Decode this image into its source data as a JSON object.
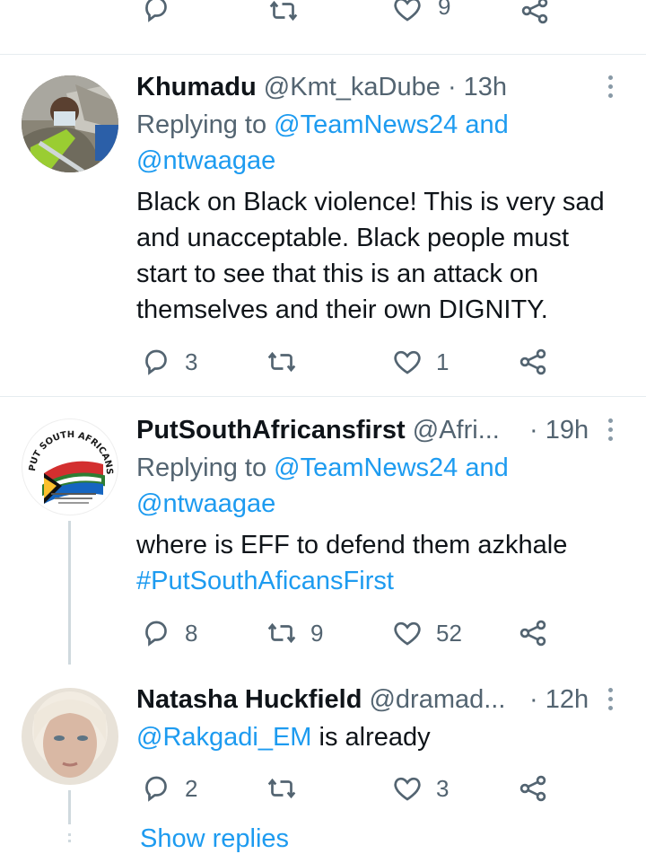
{
  "top_actions": {
    "like_count": "9"
  },
  "tweets": [
    {
      "name": "Khumadu",
      "handle": "@Kmt_kaDube",
      "sep": "·",
      "time": "13h",
      "replying_label": "Replying to",
      "replying_to_1": "@TeamNews24",
      "replying_and": "and",
      "replying_to_2": "@ntwaagae",
      "text_lines": [
        "Black on Black violence! This is very sad",
        "and unacceptable. Black people must",
        "start to see that this is an attack on",
        "themselves and their own DIGNITY."
      ],
      "reply_count": "3",
      "retweet_count": "",
      "like_count": "1"
    },
    {
      "name": "PutSouthAfricansfirst",
      "handle": "@Afri...",
      "sep": "·",
      "time": "19h",
      "replying_label": "Replying to",
      "replying_to_1": "@TeamNews24",
      "replying_and": "and",
      "replying_to_2": "@ntwaagae",
      "text_line1": "where is EFF to defend them azkhale",
      "hashtag": "#PutSouthAficansFirst",
      "reply_count": "8",
      "retweet_count": "9",
      "like_count": "52",
      "avatar_logo_text": "PUT SOUTH AFRICANS FIRST"
    },
    {
      "name": "Natasha Huckfield",
      "handle": "@dramad...",
      "sep": "·",
      "time": "12h",
      "mention": "@Rakgadi_EM",
      "text_rest": " is already",
      "reply_count": "2",
      "retweet_count": "",
      "like_count": "3"
    }
  ],
  "show_replies": "Show replies",
  "icons": {
    "reply": "reply-icon",
    "retweet": "retweet-icon",
    "like": "heart-icon",
    "share": "share-icon",
    "more": "more-icon"
  },
  "colors": {
    "link": "#1d9bf0",
    "muted": "#536471",
    "text": "#0f1419"
  }
}
